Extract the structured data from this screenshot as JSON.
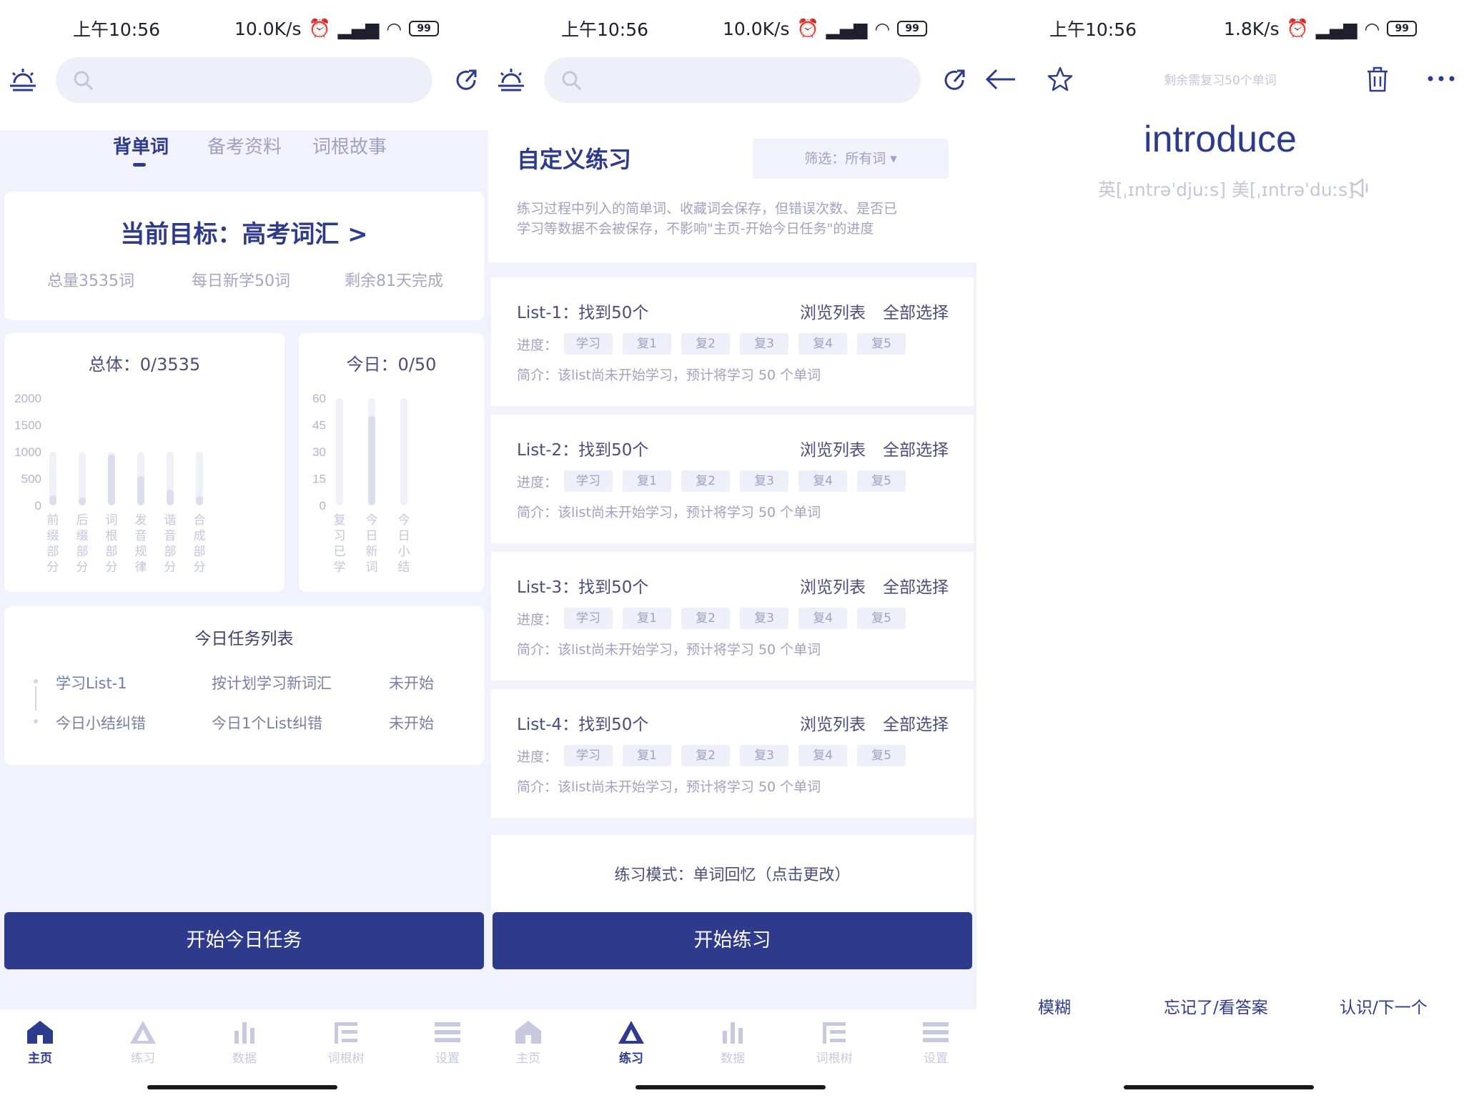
{
  "status_bars": [
    {
      "time": "上午10:56",
      "net": "10.0K/s",
      "battery": "99"
    },
    {
      "time": "上午10:56",
      "net": "10.0K/s",
      "battery": "99"
    },
    {
      "time": "上午10:56",
      "net": "1.8K/s",
      "battery": "99"
    }
  ],
  "screen1": {
    "tabs": [
      "背单词",
      "备考资料",
      "词根故事"
    ],
    "target": {
      "title": "当前目标：高考词汇 >",
      "total": "总量3535词",
      "daily": "每日新学50词",
      "remaining": "剩余81天完成"
    },
    "overall_title": "总体：0/3535",
    "today_title": "今日：0/50",
    "chart_data": [
      {
        "type": "bar",
        "title": "总体：0/3535",
        "categories": [
          "前缀部分",
          "后缀部分",
          "词根部分",
          "发音规律",
          "谐音部分",
          "合成部分"
        ],
        "track": [
          1000,
          1000,
          1000,
          1000,
          1000,
          1000
        ],
        "values": [
          190,
          150,
          950,
          550,
          290,
          170
        ],
        "yticks": [
          0,
          500,
          1000,
          1500,
          2000
        ],
        "ylim": [
          0,
          2000
        ],
        "grid": false
      },
      {
        "type": "bar",
        "title": "今日：0/50",
        "categories": [
          "复习已学",
          "今日新词",
          "今日小结"
        ],
        "values": [
          0,
          50,
          0
        ],
        "yticks": [
          0,
          15,
          30,
          45,
          60
        ],
        "ylim": [
          0,
          60
        ],
        "grid": false
      }
    ],
    "task_title": "今日任务列表",
    "tasks": [
      {
        "name": "学习List-1",
        "desc": "按计划学习新词汇",
        "status": "未开始"
      },
      {
        "name": "今日小结纠错",
        "desc": "今日1个List纠错",
        "status": "未开始"
      }
    ],
    "start_button": "开始今日任务"
  },
  "screen2": {
    "title": "自定义练习",
    "filter": "筛选：所有词 ▾",
    "desc_line1": "练习过程中列入的简单词、收藏词会保存，但错误次数、是否已",
    "desc_line2": "学习等数据不会被保存，不影响\"主页-开始今日任务\"的进度",
    "lists": [
      {
        "title": "List-1：找到50个",
        "browse": "浏览列表",
        "select_all": "全部选择",
        "progress_label": "进度：",
        "intro": "简介：该list尚未开始学习，预计将学习 50 个单词"
      },
      {
        "title": "List-2：找到50个",
        "browse": "浏览列表",
        "select_all": "全部选择",
        "progress_label": "进度：",
        "intro": "简介：该list尚未开始学习，预计将学习 50 个单词"
      },
      {
        "title": "List-3：找到50个",
        "browse": "浏览列表",
        "select_all": "全部选择",
        "progress_label": "进度：",
        "intro": "简介：该list尚未开始学习，预计将学习 50 个单词"
      },
      {
        "title": "List-4：找到50个",
        "browse": "浏览列表",
        "select_all": "全部选择",
        "progress_label": "进度：",
        "intro": "简介：该list尚未开始学习，预计将学习 50 个单词"
      }
    ],
    "stages": [
      "学习",
      "复1",
      "复2",
      "复3",
      "复4",
      "复5"
    ],
    "mode": "练习模式：单词回忆（点击更改）",
    "start_button": "开始练习"
  },
  "screen3": {
    "remaining": "剩余需复习50个单词",
    "word": "introduce",
    "phonetic": "英[ˌɪntrəˈdjuːs] 美[ˌɪntrəˈduːs]",
    "actions": [
      "模糊",
      "忘记了/看答案",
      "认识/下一个"
    ]
  },
  "nav": [
    "主页",
    "练习",
    "数据",
    "词根树",
    "设置"
  ],
  "colors": {
    "accent": "#2e3a8c",
    "page_bg": "#f1f2fb",
    "muted": "#a0a2bf"
  }
}
